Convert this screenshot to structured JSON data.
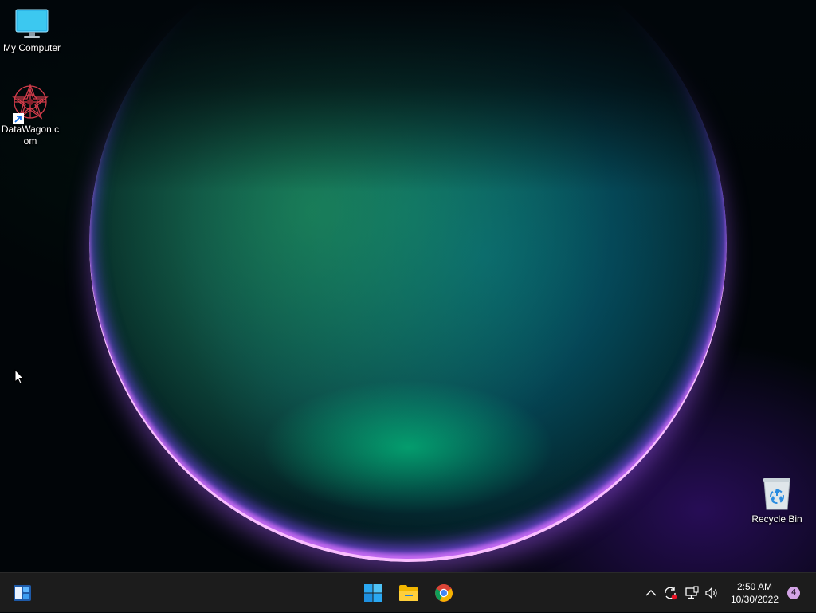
{
  "desktop": {
    "icons": [
      {
        "label": "My Computer",
        "icon": "monitor-icon"
      },
      {
        "label": "DataWagon.com",
        "label_lines": [
          "DataWagon.c",
          "om"
        ],
        "icon": "datawagon-logo-icon",
        "shortcut": true
      },
      {
        "label": "Recycle Bin",
        "icon": "recycle-bin-icon"
      }
    ]
  },
  "taskbar": {
    "pinned": [
      {
        "name": "Start",
        "icon": "windows-logo-icon"
      },
      {
        "name": "File Explorer",
        "icon": "folder-icon"
      },
      {
        "name": "Google Chrome",
        "icon": "chrome-icon"
      }
    ],
    "widgets_icon": "widgets-icon",
    "tray": {
      "icons": [
        "chevron-up-icon",
        "sync-icon",
        "network-icon",
        "volume-icon"
      ],
      "time": "2:50 AM",
      "date": "10/30/2022",
      "notification_count": "4"
    }
  },
  "colors": {
    "taskbar": "#1c1c1c",
    "windows_blue": "#2aa8f2",
    "folder_yellow": "#f2b600",
    "badge": "#d3a4e6"
  }
}
